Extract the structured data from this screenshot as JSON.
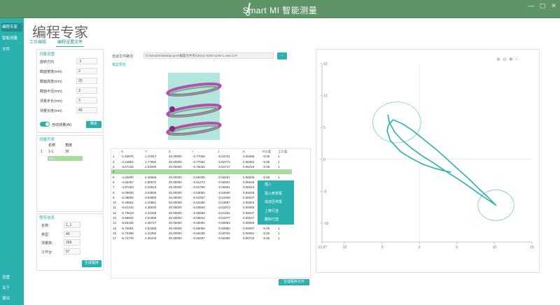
{
  "app": {
    "title": "Smart MI 智能测量",
    "window_controls": [
      "—",
      "▢",
      "✕"
    ]
  },
  "sidebar": {
    "items": [
      "编程专家",
      "智能测量",
      "文件"
    ],
    "bottom_items": [
      "设置",
      "关于",
      "退出"
    ]
  },
  "page": {
    "title": "编程专家",
    "tabs": [
      "工作编辑",
      "编程设置文件"
    ]
  },
  "params": {
    "section_title": "测量设置",
    "fields": [
      {
        "label": "旋转方向",
        "value": "-1"
      },
      {
        "label": "截面宽度(mm)",
        "value": "2"
      },
      {
        "label": "截面高度(mm)",
        "value": "20"
      },
      {
        "label": "截面半径(mm)",
        "value": "3"
      },
      {
        "label": "测量步长(mm)",
        "value": "3"
      },
      {
        "label": "测量长度(mm)",
        "value": "40"
      }
    ],
    "toggle_label": "自动测量(AI)",
    "toggle_button": "确定"
  },
  "angle_list": {
    "title": "测量列表",
    "headers": [
      "名称",
      "角度"
    ],
    "rows": [
      {
        "idx": "1",
        "name": "1-1",
        "angle": "30"
      }
    ],
    "selected_text": "1-2 ..."
  },
  "bottom_form": {
    "title": "程序信息",
    "fields": [
      {
        "label": "名称:",
        "value": "1_1"
      },
      {
        "label": "类型:",
        "value": "40"
      },
      {
        "label": "测量数:",
        "value": "269"
      },
      {
        "label": "工作台:",
        "value": "57"
      }
    ],
    "button": "生成程序"
  },
  "file": {
    "label": "自适文件路径:",
    "path": "D:\\Smartmi\\data\\project\\截面文件夹\\(3621)-0200-1100-1.nwa.CAT",
    "button": "..."
  },
  "model": {
    "label": "模型预览"
  },
  "table": {
    "headers": [
      "",
      "X",
      "Y",
      "Z",
      "I",
      "J",
      "K",
      "R公差",
      "上公差"
    ],
    "rows": [
      [
        "1",
        "-1.53876",
        "1.47917",
        "40.00000",
        "-0.77059",
        "-0.63701",
        "0.06286",
        "-0.05",
        "1"
      ],
      [
        "2",
        "-2.24851",
        "1.77882",
        "40.00000",
        "-0.77062",
        "-0.62774",
        "0.06352",
        "-0.05",
        "1"
      ],
      [
        "3",
        "-3.07425",
        "2.01000",
        "40.00000",
        "-0.76032",
        "-0.61717",
        "0.06419",
        "-0.05",
        "1"
      ],
      [
        "4",
        "",
        "",
        "",
        "",
        "",
        "",
        "",
        ""
      ],
      [
        "5",
        "-4.42800",
        "2.46566",
        "40.00000",
        "-0.68400",
        "-0.58467",
        "0.06508",
        "-0.05",
        "1"
      ],
      [
        "6",
        "-4.65467",
        "2.80972",
        "40.00000",
        "-0.61273",
        "-0.58301",
        "0.06528",
        "-0.05",
        "1"
      ],
      [
        "7",
        "-4.87263",
        "3.22943",
        "40.00000",
        "-0.52796",
        "-0.56961",
        "0.06313",
        "-0.05",
        "1"
      ],
      [
        "8",
        "-5.09830",
        "3.53506",
        "40.00000",
        "-0.53000",
        "-0.54690",
        "0.06028",
        "-0.05",
        "1"
      ],
      [
        "9",
        "-5.38808",
        "3.84960",
        "40.00000",
        "-0.53307",
        "-0.54259",
        "0.06037",
        "-0.05",
        "1"
      ],
      [
        "10",
        "-5.49651",
        "4.10861",
        "40.00000",
        "-0.53486",
        "-0.53987",
        "0.06004",
        "-0.05",
        "1"
      ],
      [
        "11",
        "-5.61442",
        "4.36020",
        "40.00000",
        "-0.53663",
        "-0.61973",
        "0.06065",
        "-0.05",
        "1"
      ],
      [
        "12",
        "-5.70518",
        "4.44268",
        "40.00000",
        "-0.55568",
        "-0.61331",
        "0.06037",
        "-0.05",
        "1"
      ],
      [
        "13",
        "-5.88844",
        "4.61960",
        "40.00000",
        "-0.56044",
        "-0.61077",
        "0.06047",
        "-0.05",
        "1"
      ],
      [
        "14",
        "-5.83436",
        "4.46727",
        "40.00000",
        "-0.56084",
        "-0.50883",
        "0.06059",
        "-0.05",
        "1"
      ],
      [
        "15",
        "-5.70691",
        "4.51958",
        "40.00000",
        "-0.56065",
        "-0.50880",
        "0.06097",
        "-0.05",
        "1"
      ],
      [
        "16",
        "-5.70288",
        "4.44392",
        "40.00000",
        "-0.56238",
        "-0.50704",
        "0.06091",
        "-0.05",
        "1"
      ],
      [
        "17",
        "-5.74776",
        "4.36433",
        "40.00000",
        "-0.56497",
        "-0.50382",
        "0.06704",
        "-0.05",
        "1"
      ]
    ],
    "generate_button": "生成程序文件"
  },
  "context_menu": {
    "items": [
      "插入",
      "插入到末尾",
      "追加至末尾",
      "上移行选",
      "删除已选"
    ]
  },
  "colors": {
    "sidebar": "#2ab0ae",
    "titlebar": "#5e9468",
    "accent": "#2ab0ae"
  },
  "chart_data": {
    "type": "line",
    "series": [
      {
        "x": [
          4.2,
          3.3,
          2.0,
          0.5,
          -1.0,
          -2.5,
          -3.9,
          -4.3,
          -4.1,
          -3.5,
          -2.3,
          -1.0,
          0.5,
          2.2,
          3.8,
          5.3,
          6.7,
          8.0,
          9.2,
          10.2,
          9.6,
          8.7,
          7.6,
          6.3,
          4.9,
          3.3,
          1.8,
          0.3,
          -1.1,
          -2.3,
          -3.3,
          -4.0,
          -4.2
        ],
        "y": [
          -2.0,
          -1.8,
          -1.4,
          -0.8,
          0.1,
          1.2,
          3.0,
          4.5,
          5.4,
          6.2,
          5.6,
          4.6,
          3.2,
          1.6,
          -0.1,
          -1.7,
          -3.2,
          -4.7,
          -6.0,
          -7.2,
          -6.7,
          -6.0,
          -5.1,
          -4.0,
          -2.9,
          -1.7,
          -0.5,
          0.6,
          1.8,
          3.0,
          4.3,
          5.8,
          7.0
        ]
      }
    ],
    "circles": [
      {
        "cx": -3.0,
        "cy": 5.8,
        "r": 3.2
      },
      {
        "cx": 10.2,
        "cy": -7.2,
        "r": 2.4
      }
    ],
    "xlim": [
      -12.97,
      15
    ],
    "ylim": [
      -12.97,
      15
    ],
    "xticks": [
      "-12.97",
      "-10",
      "-5",
      "0",
      "5",
      "10",
      "15"
    ],
    "yticks": [
      "15",
      "10",
      "5",
      "0",
      "-5",
      "-10"
    ]
  }
}
